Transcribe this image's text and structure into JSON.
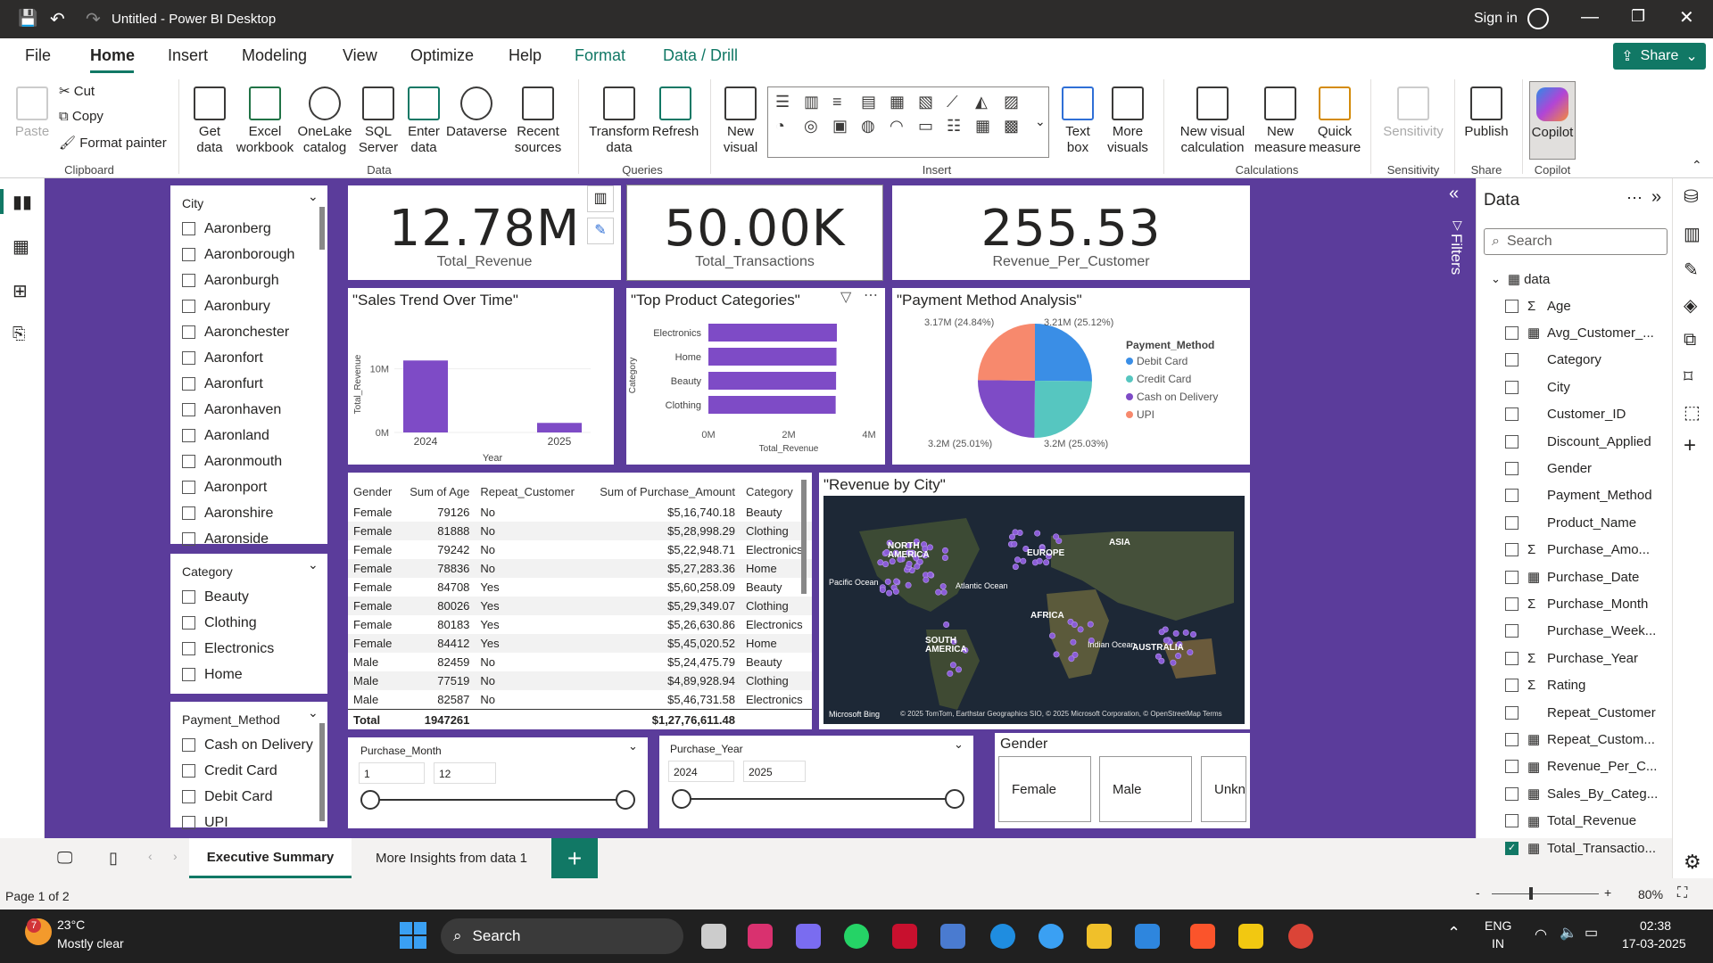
{
  "app": {
    "title": "Untitled - Power BI Desktop",
    "signin": "Sign in"
  },
  "menu": {
    "items": [
      "File",
      "Home",
      "Insert",
      "Modeling",
      "View",
      "Optimize",
      "Help",
      "Format",
      "Data / Drill"
    ],
    "share": "Share"
  },
  "ribbon": {
    "clipboard": {
      "paste": "Paste",
      "cut": "Cut",
      "copy": "Copy",
      "format_painter": "Format painter",
      "group": "Clipboard"
    },
    "data": {
      "buttons": [
        "Get data",
        "Excel workbook",
        "OneLake catalog",
        "SQL Server",
        "Enter data",
        "Dataverse",
        "Recent sources"
      ],
      "group": "Data"
    },
    "queries": {
      "buttons": [
        "Transform data",
        "Refresh"
      ],
      "group": "Queries"
    },
    "insert": {
      "new_visual": "New visual",
      "text_box": "Text box",
      "more_visuals": "More visuals",
      "group": "Insert"
    },
    "calculations": {
      "buttons": [
        "New visual calculation",
        "New measure",
        "Quick measure"
      ],
      "group": "Calculations"
    },
    "sensitivity": {
      "button": "Sensitivity",
      "group": "Sensitivity"
    },
    "share": {
      "button": "Publish",
      "group": "Share"
    },
    "copilot": {
      "button": "Copilot",
      "group": "Copilot"
    }
  },
  "slicers": {
    "city": {
      "title": "City",
      "items": [
        "Aaronberg",
        "Aaronborough",
        "Aaronburgh",
        "Aaronbury",
        "Aaronchester",
        "Aaronfort",
        "Aaronfurt",
        "Aaronhaven",
        "Aaronland",
        "Aaronmouth",
        "Aaronport",
        "Aaronshire",
        "Aaronside"
      ]
    },
    "category": {
      "title": "Category",
      "items": [
        "Beauty",
        "Clothing",
        "Electronics",
        "Home"
      ]
    },
    "payment": {
      "title": "Payment_Method",
      "items": [
        "Cash on Delivery",
        "Credit Card",
        "Debit Card",
        "UPI"
      ]
    },
    "month": {
      "title": "Purchase_Month",
      "from": "1",
      "to": "12"
    },
    "year": {
      "title": "Purchase_Year",
      "from": "2024",
      "to": "2025"
    },
    "gender": {
      "title": "Gender",
      "buttons": [
        "Female",
        "Male",
        "Unknown"
      ]
    }
  },
  "kpis": [
    {
      "value": "12.78M",
      "label": "Total_Revenue"
    },
    {
      "value": "50.00K",
      "label": "Total_Transactions"
    },
    {
      "value": "255.53",
      "label": "Revenue_Per_Customer"
    }
  ],
  "chart_data": [
    {
      "type": "bar",
      "title": "\"Sales Trend Over Time\"",
      "categories": [
        "2024",
        "2025"
      ],
      "values": [
        11.3,
        1.5
      ],
      "xlabel": "Year",
      "ylabel": "Total_Revenue",
      "yticks": [
        "0M",
        "10M"
      ],
      "ylim": [
        0,
        14
      ],
      "color": "#7e4bc6"
    },
    {
      "type": "bar",
      "orientation": "horizontal",
      "title": "\"Top Product Categories\"",
      "categories": [
        "Electronics",
        "Home",
        "Beauty",
        "Clothing"
      ],
      "values": [
        3.2,
        3.19,
        3.18,
        3.17
      ],
      "xlabel": "Total_Revenue",
      "ylabel": "Category",
      "xticks": [
        "0M",
        "2M",
        "4M"
      ],
      "xlim": [
        0,
        4
      ],
      "color": "#7e4bc6"
    },
    {
      "type": "pie",
      "title": "\"Payment Method Analysis\"",
      "legend_title": "Payment_Method",
      "series": [
        {
          "name": "Debit Card",
          "value": 3.21,
          "label": "3.21M (25.12%)",
          "color": "#3a8ee6"
        },
        {
          "name": "Credit Card",
          "value": 3.2,
          "label": "3.2M (25.03%)",
          "color": "#56c6c0"
        },
        {
          "name": "Cash on Delivery",
          "value": 3.2,
          "label": "3.2M (25.01%)",
          "color": "#7e4bc6"
        },
        {
          "name": "UPI",
          "value": 3.17,
          "label": "3.17M (24.84%)",
          "color": "#f7896d"
        }
      ]
    }
  ],
  "table": {
    "headers": [
      "Gender",
      "Sum of Age",
      "Repeat_Customer",
      "Sum of Purchase_Amount",
      "Category"
    ],
    "rows": [
      [
        "Female",
        "79126",
        "No",
        "$5,16,740.18",
        "Beauty"
      ],
      [
        "Female",
        "81888",
        "No",
        "$5,28,998.29",
        "Clothing"
      ],
      [
        "Female",
        "79242",
        "No",
        "$5,22,948.71",
        "Electronics"
      ],
      [
        "Female",
        "78836",
        "No",
        "$5,27,283.36",
        "Home"
      ],
      [
        "Female",
        "84708",
        "Yes",
        "$5,60,258.09",
        "Beauty"
      ],
      [
        "Female",
        "80026",
        "Yes",
        "$5,29,349.07",
        "Clothing"
      ],
      [
        "Female",
        "80183",
        "Yes",
        "$5,26,630.86",
        "Electronics"
      ],
      [
        "Female",
        "84412",
        "Yes",
        "$5,45,020.52",
        "Home"
      ],
      [
        "Male",
        "82459",
        "No",
        "$5,24,475.79",
        "Beauty"
      ],
      [
        "Male",
        "77519",
        "No",
        "$4,89,928.94",
        "Clothing"
      ],
      [
        "Male",
        "82587",
        "No",
        "$5,46,731.58",
        "Electronics"
      ]
    ],
    "total": [
      "Total",
      "1947261",
      "",
      "$1,27,76,611.48",
      ""
    ]
  },
  "map": {
    "title": "\"Revenue by City\"",
    "labels": [
      "NORTH AMERICA",
      "EUROPE",
      "ASIA",
      "Pacific Ocean",
      "Atlantic Ocean",
      "AFRICA",
      "SOUTH AMERICA",
      "Indian Ocean",
      "AUSTRALIA"
    ],
    "brand": "Microsoft Bing",
    "credits": "© 2025 TomTom, Earthstar Geographics SIO, © 2025 Microsoft Corporation, © OpenStreetMap  Terms"
  },
  "filters_label": "Filters",
  "data_pane": {
    "title": "Data",
    "search": "Search",
    "table": "data",
    "fields": [
      {
        "name": "Age",
        "sigma": true,
        "checked": false
      },
      {
        "name": "Avg_Customer_...",
        "calc": true,
        "checked": false
      },
      {
        "name": "Category",
        "checked": false
      },
      {
        "name": "City",
        "checked": false
      },
      {
        "name": "Customer_ID",
        "checked": false
      },
      {
        "name": "Discount_Applied",
        "checked": false
      },
      {
        "name": "Gender",
        "checked": false
      },
      {
        "name": "Payment_Method",
        "checked": false
      },
      {
        "name": "Product_Name",
        "checked": false
      },
      {
        "name": "Purchase_Amo...",
        "sigma": true,
        "checked": false
      },
      {
        "name": "Purchase_Date",
        "calc": true,
        "checked": false
      },
      {
        "name": "Purchase_Month",
        "sigma": true,
        "checked": false
      },
      {
        "name": "Purchase_Week...",
        "checked": false
      },
      {
        "name": "Purchase_Year",
        "sigma": true,
        "checked": false
      },
      {
        "name": "Rating",
        "sigma": true,
        "checked": false
      },
      {
        "name": "Repeat_Customer",
        "checked": false
      },
      {
        "name": "Repeat_Custom...",
        "calc": true,
        "checked": false
      },
      {
        "name": "Revenue_Per_C...",
        "calc": true,
        "checked": false
      },
      {
        "name": "Sales_By_Categ...",
        "calc": true,
        "checked": false
      },
      {
        "name": "Total_Revenue",
        "calc": true,
        "checked": false
      },
      {
        "name": "Total_Transactio...",
        "calc": true,
        "checked": true
      }
    ]
  },
  "tabs": {
    "pages": [
      "Executive Summary",
      "More Insights from data 1"
    ],
    "add": "+"
  },
  "status": {
    "page": "Page 1 of 2",
    "zoom": "80%"
  },
  "taskbar": {
    "temp": "23°C",
    "weather": "Mostly clear",
    "search": "Search",
    "lang1": "ENG",
    "lang2": "IN",
    "time": "02:38",
    "date": "17-03-2025",
    "badge": "7"
  }
}
